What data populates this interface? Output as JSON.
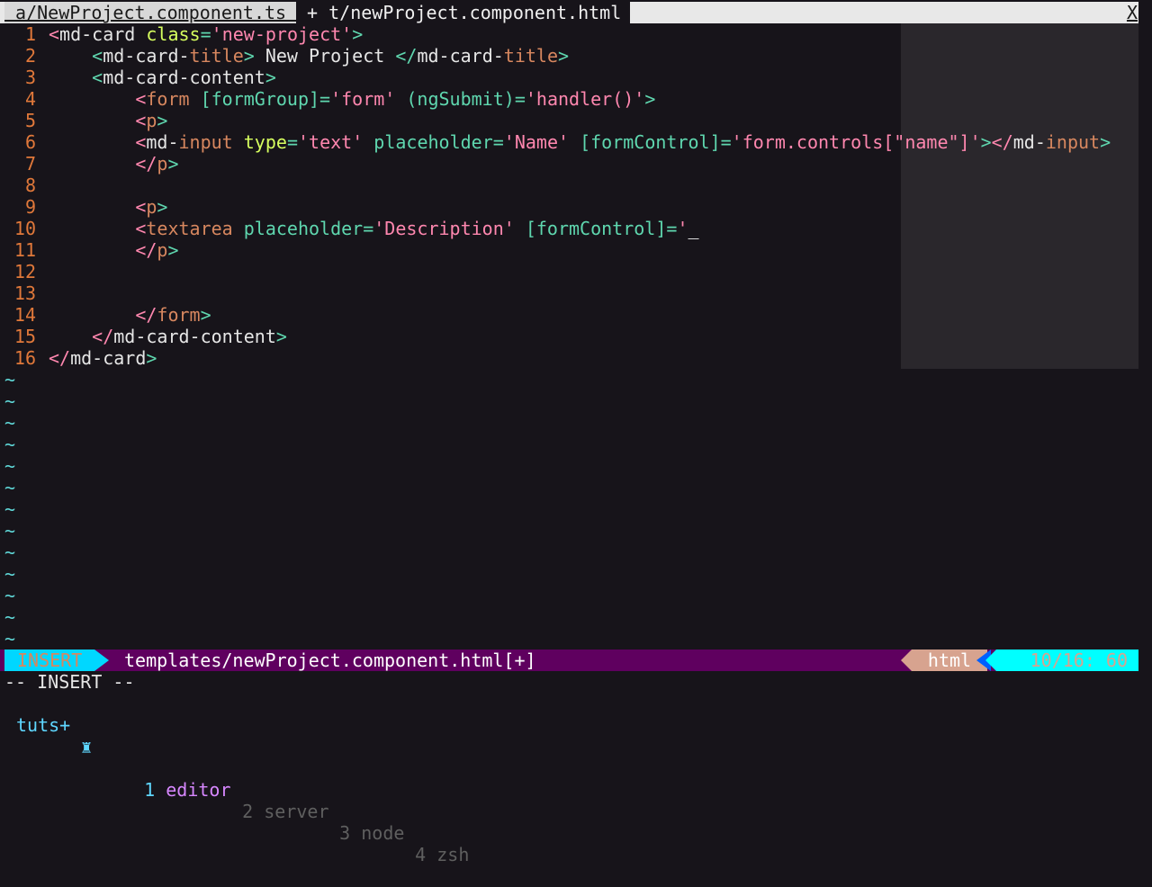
{
  "tabs": [
    {
      "label": " a/NewProject.component.ts ",
      "active": false
    },
    {
      "label": " + t/newProject.component.html ",
      "active": true
    }
  ],
  "tab_close": "X",
  "lines": [
    {
      "num": "1",
      "tokens": [
        [
          "tag",
          "<"
        ],
        [
          "text",
          "md-card"
        ],
        [
          "text",
          " "
        ],
        [
          "attr",
          "class"
        ],
        [
          "punct",
          "="
        ],
        [
          "str",
          "'new-project'"
        ],
        [
          "tagname",
          ">"
        ]
      ]
    },
    {
      "num": "2",
      "tokens": [
        [
          "text",
          "    "
        ],
        [
          "tagname",
          "<"
        ],
        [
          "text",
          "md-card-"
        ],
        [
          "elem",
          "title"
        ],
        [
          "tagname",
          ">"
        ],
        [
          "text",
          " New Project "
        ],
        [
          "tagname",
          "</"
        ],
        [
          "text",
          "md-card-"
        ],
        [
          "elem",
          "title"
        ],
        [
          "tagname",
          ">"
        ]
      ]
    },
    {
      "num": "3",
      "tokens": [
        [
          "text",
          "    "
        ],
        [
          "tagname",
          "<"
        ],
        [
          "text",
          "md-card-content"
        ],
        [
          "tagname",
          ">"
        ]
      ]
    },
    {
      "num": "4",
      "tokens": [
        [
          "text",
          "        "
        ],
        [
          "tag",
          "<"
        ],
        [
          "elem",
          "form"
        ],
        [
          "text",
          " "
        ],
        [
          "attr2",
          "[formGroup]"
        ],
        [
          "punct",
          "="
        ],
        [
          "str",
          "'form'"
        ],
        [
          "text",
          " "
        ],
        [
          "attr2",
          "(ngSubmit)"
        ],
        [
          "punct",
          "="
        ],
        [
          "str",
          "'handler()'"
        ],
        [
          "tagname",
          ">"
        ]
      ]
    },
    {
      "num": "5",
      "tokens": [
        [
          "text",
          "        "
        ],
        [
          "tag",
          "<"
        ],
        [
          "elem",
          "p"
        ],
        [
          "tagname",
          ">"
        ]
      ]
    },
    {
      "num": "6",
      "tokens": [
        [
          "text",
          "        "
        ],
        [
          "tag",
          "<"
        ],
        [
          "text",
          "md-"
        ],
        [
          "elem",
          "input"
        ],
        [
          "text",
          " "
        ],
        [
          "attr",
          "type"
        ],
        [
          "punct",
          "="
        ],
        [
          "str",
          "'text'"
        ],
        [
          "text",
          " "
        ],
        [
          "attr2",
          "placeholder"
        ],
        [
          "punct",
          "="
        ],
        [
          "str",
          "'Name'"
        ],
        [
          "text",
          " "
        ],
        [
          "attr2",
          "[formControl]"
        ],
        [
          "punct",
          "="
        ],
        [
          "str",
          "'form.controls[\"name\"]'"
        ],
        [
          "tagname",
          ">"
        ],
        [
          "tag",
          "</"
        ],
        [
          "text",
          "md-"
        ],
        [
          "elem",
          "input"
        ],
        [
          "tagname",
          ">"
        ]
      ]
    },
    {
      "num": "7",
      "tokens": [
        [
          "text",
          "        "
        ],
        [
          "tag",
          "</"
        ],
        [
          "elem",
          "p"
        ],
        [
          "tagname",
          ">"
        ]
      ]
    },
    {
      "num": "8",
      "tokens": []
    },
    {
      "num": "9",
      "tokens": [
        [
          "text",
          "        "
        ],
        [
          "tag",
          "<"
        ],
        [
          "elem",
          "p"
        ],
        [
          "tagname",
          ">"
        ]
      ]
    },
    {
      "num": "10",
      "tokens": [
        [
          "text",
          "        "
        ],
        [
          "tag",
          "<"
        ],
        [
          "elem",
          "textarea"
        ],
        [
          "text",
          " "
        ],
        [
          "attr2",
          "placeholder"
        ],
        [
          "punct",
          "="
        ],
        [
          "str",
          "'Description'"
        ],
        [
          "text",
          " "
        ],
        [
          "attr2",
          "[formControl]"
        ],
        [
          "punct",
          "="
        ],
        [
          "str",
          "'"
        ],
        [
          "cursor",
          "_"
        ]
      ]
    },
    {
      "num": "11",
      "tokens": [
        [
          "text",
          "        "
        ],
        [
          "tag",
          "</"
        ],
        [
          "elem",
          "p"
        ],
        [
          "tagname",
          ">"
        ]
      ]
    },
    {
      "num": "12",
      "tokens": []
    },
    {
      "num": "13",
      "tokens": []
    },
    {
      "num": "14",
      "tokens": [
        [
          "text",
          "        "
        ],
        [
          "tag",
          "</"
        ],
        [
          "elem",
          "form"
        ],
        [
          "tagname",
          ">"
        ]
      ]
    },
    {
      "num": "15",
      "tokens": [
        [
          "text",
          "    "
        ],
        [
          "tag",
          "</"
        ],
        [
          "text",
          "md-card-content"
        ],
        [
          "tagname",
          ">"
        ]
      ]
    },
    {
      "num": "16",
      "tokens": [
        [
          "tag",
          "</"
        ],
        [
          "text",
          "md-card"
        ],
        [
          "tagname",
          ">"
        ]
      ]
    }
  ],
  "tilde_char": "~",
  "tilde_count": 13,
  "statusline": {
    "mode": "INSERT",
    "filepath": "templates/newProject.component.html[+]",
    "filetype": "html",
    "position": "10/16: 60"
  },
  "cmdline": "-- INSERT --",
  "tmux": {
    "session": "tuts+",
    "icon": "♜",
    "windows": [
      {
        "num": "1",
        "name": "editor",
        "active": true
      },
      {
        "num": "2",
        "name": "server",
        "active": false
      },
      {
        "num": "3",
        "name": "node",
        "active": false
      },
      {
        "num": "4",
        "name": "zsh",
        "active": false
      }
    ]
  },
  "colors": {
    "background": "#17141a",
    "mode_bg": "#00d7ff",
    "status_bg": "#5f005f",
    "position_bg": "#00ffff",
    "filetype_bg": "#d7a38f"
  }
}
